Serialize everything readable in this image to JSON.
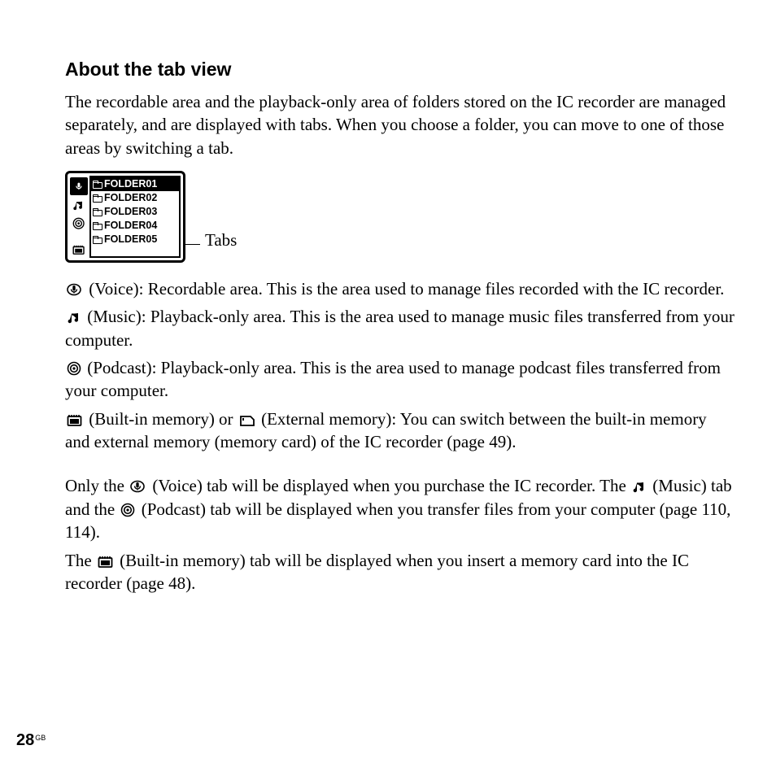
{
  "heading": "About the tab view",
  "intro": "The recordable area and the playback-only area of folders stored on the IC recorder are managed separately, and are displayed with tabs. When you choose a folder, you can move to one of those areas by switching a tab.",
  "figure": {
    "folders": [
      "FOLDER01",
      "FOLDER02",
      "FOLDER03",
      "FOLDER04",
      "FOLDER05"
    ],
    "annotation": "Tabs"
  },
  "definitions": {
    "voice_label": " (Voice): Recordable area. This is the area used to manage files recorded with the IC recorder.",
    "music_label": " (Music): Playback-only area. This is the area used to manage music files transferred from your computer.",
    "podcast_label": " (Podcast): Playback-only area. This is the area used to manage podcast files transferred from your computer.",
    "memory_first": " (Built-in memory) or ",
    "memory_second": " (External memory): You can switch between the built-in memory and external memory (memory card) of the IC recorder (page 49)."
  },
  "notes": {
    "line1_a": "Only the ",
    "line1_b": " (Voice) tab will be displayed when you purchase the IC recorder. The ",
    "line2_a": " (Music) tab and the ",
    "line2_b": " (Podcast) tab will be displayed when you transfer files from your computer (page 110, 114).",
    "line3_a": "The ",
    "line3_b": " (Built-in memory) tab will be displayed when you insert a memory card into the IC recorder (page 48)."
  },
  "page_number": "28",
  "page_suffix": "GB"
}
